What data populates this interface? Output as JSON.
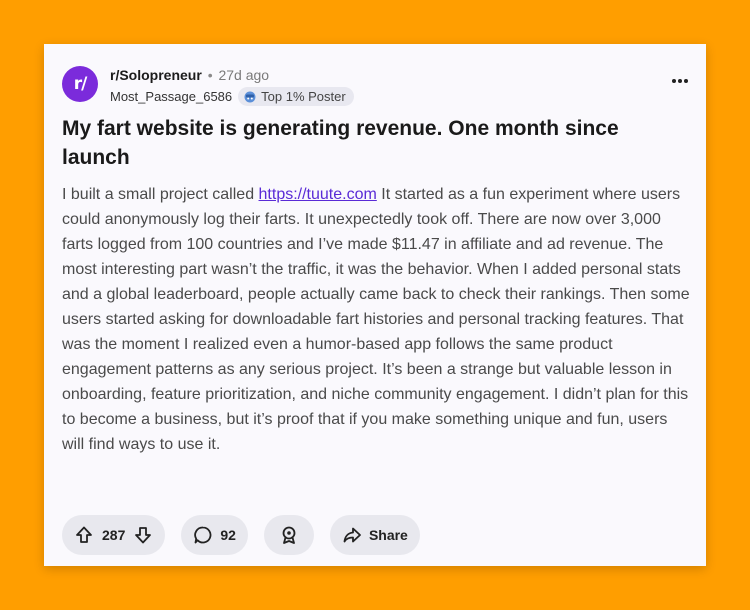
{
  "post": {
    "subreddit": "r/Solopreneur",
    "age": "27d ago",
    "author": "Most_Passage_6586",
    "badge": "Top 1% Poster",
    "title": "My fart website is generating revenue. One month since launch",
    "body_before_link": "I built a small project called ",
    "link": "https://tuute.com",
    "body_after_link": " It started as a fun experiment where users could anonymously log their farts. It unexpectedly took off. There are now over 3,000 farts logged from 100 countries and I’ve made $11.47 in affiliate and ad revenue. The most interesting part wasn’t the traffic, it was the behavior. When I added personal stats and a global leaderboard, people actually came back to check their rankings. Then some users started asking for downloadable fart histories and personal tracking features. That was the moment I realized even a humor-based app follows the same product engagement patterns as any serious project. It’s been a strange but valuable lesson in onboarding, feature prioritization, and niche community engagement. I didn’t plan for this to become a business, but it’s proof that if you make something unique and fun, users will find ways to use it."
  },
  "actions": {
    "votes": "287",
    "comments": "92",
    "share_label": "Share"
  },
  "icons": {
    "avatar_text": "r/",
    "avatar_color": "#7B2BDB",
    "upvote": "arrow-up-icon",
    "downvote": "arrow-down-icon",
    "comment": "comment-bubble-icon",
    "award": "award-icon",
    "share": "share-arrow-icon",
    "more": "more-dots-icon",
    "badge": "flair-icon"
  },
  "colors": {
    "background": "#FF9E00",
    "card": "#FAF9FD",
    "link": "#5a2bd6"
  }
}
